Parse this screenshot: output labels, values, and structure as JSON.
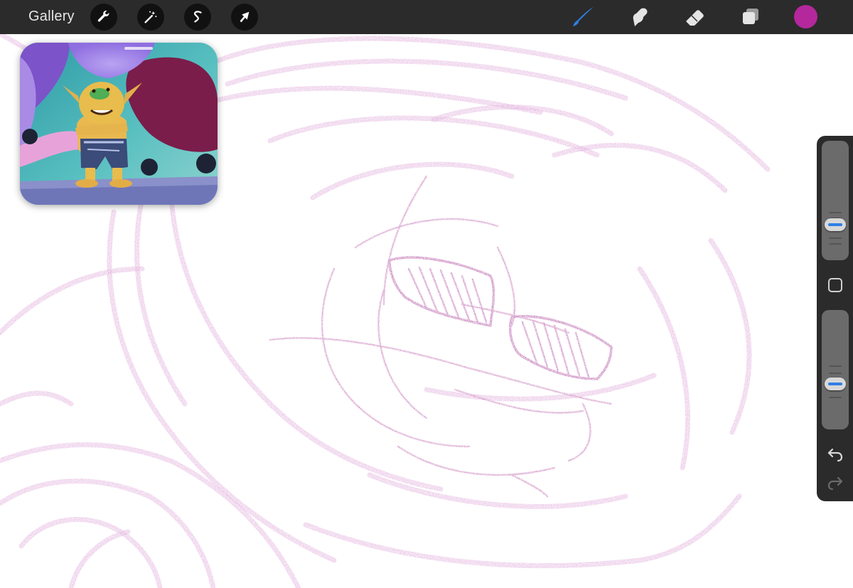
{
  "toolbar": {
    "gallery_label": "Gallery",
    "left_tools": [
      "wrench-icon",
      "magic-wand-icon",
      "selection-icon",
      "transform-arrow-icon"
    ],
    "right_tools": [
      "brush-icon",
      "smudge-icon",
      "eraser-icon",
      "layers-icon"
    ],
    "active_tool": "brush-icon",
    "active_tool_color": "#2f7fe5",
    "current_color": "#b5279c"
  },
  "reference": {
    "icon": "reference-image"
  },
  "sidebar": {
    "brush_size_level": 0.25,
    "opacity_level": 0.35,
    "modifier_icon": "square-icon",
    "undo_icon": "undo-icon",
    "redo_icon": "redo-icon"
  },
  "canvas": {
    "stroke_color": "#c75fbb"
  }
}
